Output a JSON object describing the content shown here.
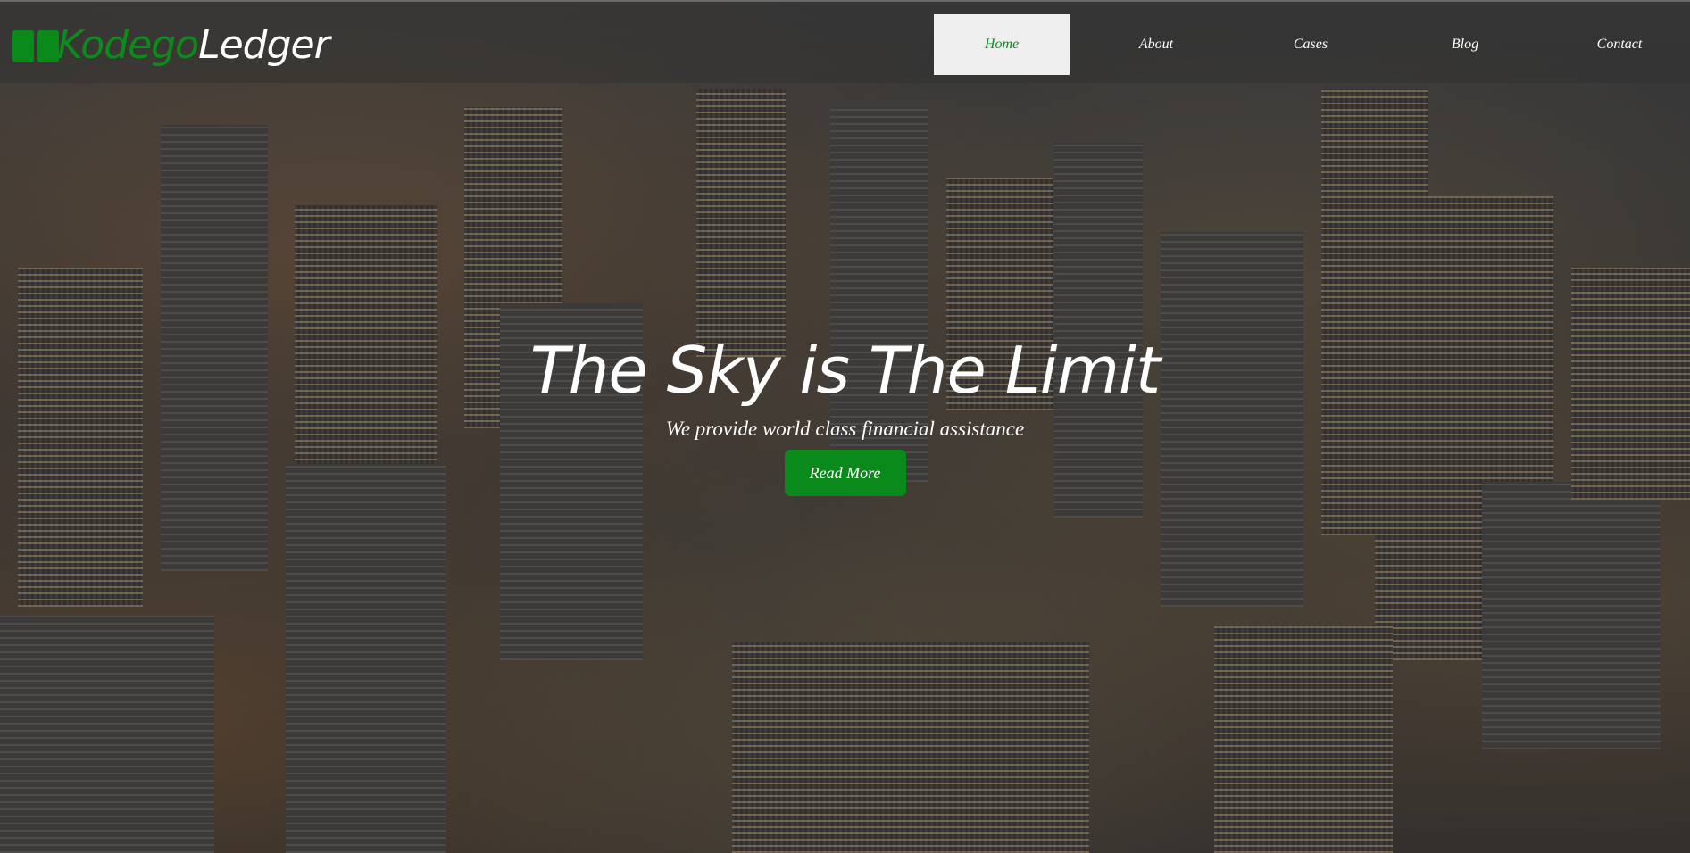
{
  "brand": {
    "name_part1": "Kodego",
    "name_part2": "Ledger",
    "accent_color": "#0c8a1c"
  },
  "nav": {
    "items": [
      {
        "label": "Home",
        "active": true
      },
      {
        "label": "About",
        "active": false
      },
      {
        "label": "Cases",
        "active": false
      },
      {
        "label": "Blog",
        "active": false
      },
      {
        "label": "Contact",
        "active": false
      }
    ]
  },
  "hero": {
    "title": "The Sky is The Limit",
    "subtitle": "We provide world class financial assistance",
    "cta_label": "Read More",
    "background": "night city skyline aerial"
  }
}
